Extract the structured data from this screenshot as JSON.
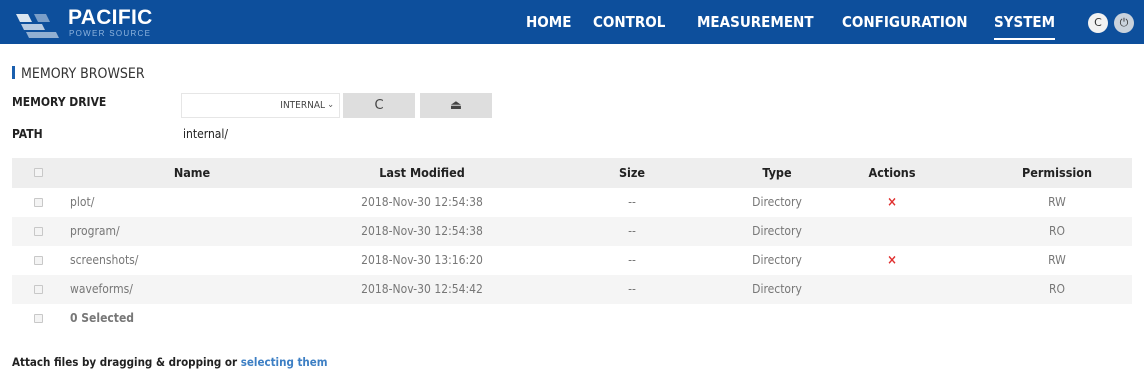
{
  "brand": {
    "name": "PACIFIC",
    "sub": "POWER SOURCE"
  },
  "nav": {
    "items": [
      {
        "label": "HOME"
      },
      {
        "label": "CONTROL"
      },
      {
        "label": "MEASUREMENT"
      },
      {
        "label": "CONFIGURATION"
      },
      {
        "label": "SYSTEM",
        "active": true
      }
    ],
    "buttons": [
      {
        "icon": "refresh-icon",
        "glyph": "C"
      },
      {
        "icon": "power-icon",
        "glyph": "⏻"
      }
    ]
  },
  "memory_browser": {
    "title": "MEMORY BROWSER",
    "drive_label": "MEMORY DRIVE",
    "drive_value": "INTERNAL",
    "drive_chevron": "⌄",
    "refresh_glyph": "C",
    "eject_glyph": "⏏",
    "path_label": "PATH",
    "path_value": "internal/"
  },
  "table": {
    "headers": {
      "name": "Name",
      "modified": "Last Modified",
      "size": "Size",
      "type": "Type",
      "actions": "Actions",
      "permission": "Permission"
    },
    "rows": [
      {
        "name": "plot/",
        "modified": "2018-Nov-30 12:54:38",
        "size": "--",
        "type": "Directory",
        "deletable": true,
        "permission": "RW"
      },
      {
        "name": "program/",
        "modified": "2018-Nov-30 12:54:38",
        "size": "--",
        "type": "Directory",
        "deletable": false,
        "permission": "RO"
      },
      {
        "name": "screenshots/",
        "modified": "2018-Nov-30 13:16:20",
        "size": "--",
        "type": "Directory",
        "deletable": true,
        "permission": "RW"
      },
      {
        "name": "waveforms/",
        "modified": "2018-Nov-30 12:54:42",
        "size": "--",
        "type": "Directory",
        "deletable": false,
        "permission": "RO"
      }
    ],
    "delete_glyph": "×",
    "selected_text": "0 Selected"
  },
  "attach": {
    "text": "Attach files by dragging & dropping or ",
    "link": "selecting them"
  },
  "colors": {
    "nav_bg": "#0d4f9c",
    "link": "#3d7fc4",
    "delete": "#e0302f",
    "header_bg": "#eeeeee"
  }
}
